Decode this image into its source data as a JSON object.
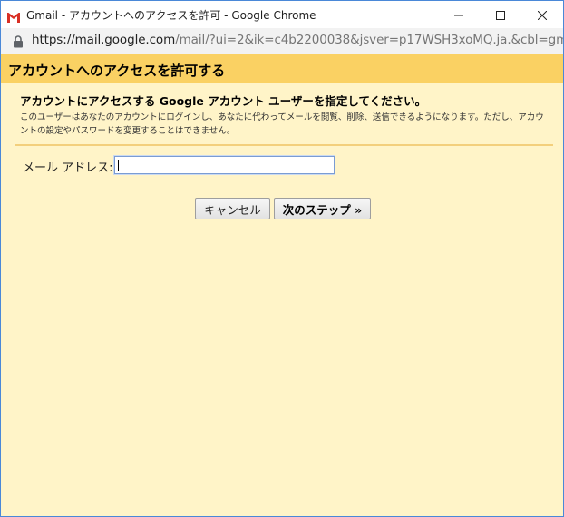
{
  "window": {
    "title": "Gmail - アカウントへのアクセスを許可 - Google Chrome",
    "app_icon": "gmail-icon",
    "controls": {
      "minimize_icon": "minimize-icon",
      "maximize_icon": "maximize-icon",
      "close_icon": "close-icon"
    }
  },
  "addressbar": {
    "lock_icon": "lock-icon",
    "url_host": "https://mail.google.com",
    "url_path": "/mail/?ui=2&ik=c4b2200038&jsver=p17WSH3xoMQ.ja.&cbl=gma..."
  },
  "dialog": {
    "title": "アカウントへのアクセスを許可する",
    "instruction": "アカウントにアクセスする Google アカウント ユーザーを指定してください。",
    "description": "このユーザーはあなたのアカウントにログインし、あなたに代わってメールを閲覧、削除、送信できるようになります。ただし、アカウントの設定やパスワードを変更することはできません。",
    "email_label": "メール アドレス:",
    "email_value": "",
    "cancel_label": "キャンセル",
    "next_label": "次のステップ »"
  },
  "colors": {
    "header_bg": "#fad163",
    "content_bg": "#fff4c8",
    "window_border": "#4a88d8",
    "gmail_red": "#d93025"
  }
}
